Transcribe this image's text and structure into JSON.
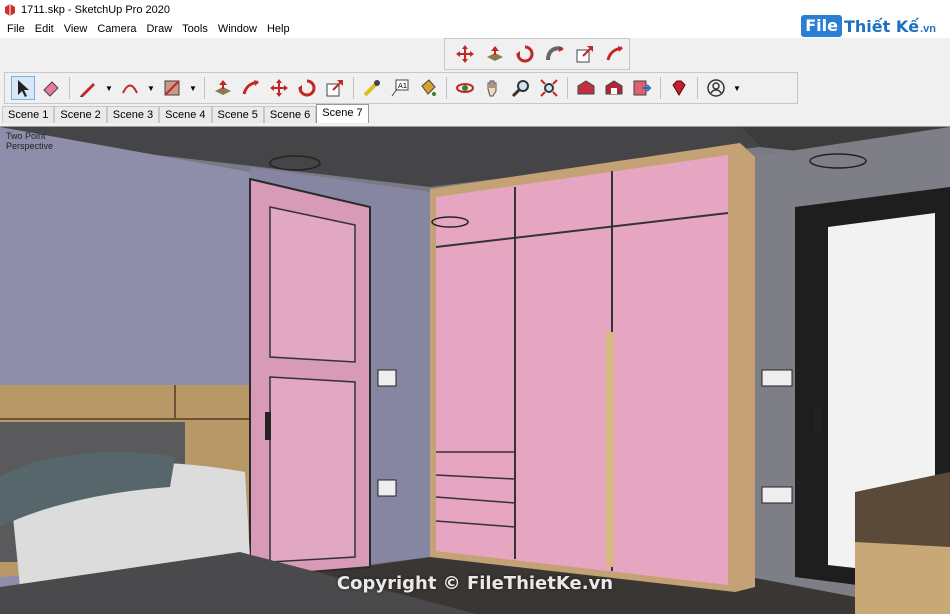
{
  "window": {
    "title": "1711.skp - SketchUp Pro 2020"
  },
  "menu": [
    "File",
    "Edit",
    "View",
    "Camera",
    "Draw",
    "Tools",
    "Window",
    "Help"
  ],
  "brand": {
    "file": "File",
    "rest": "Thiết Kế",
    "tld": ".vn"
  },
  "scenes": [
    "Scene 1",
    "Scene 2",
    "Scene 3",
    "Scene 4",
    "Scene 5",
    "Scene 6",
    "Scene 7"
  ],
  "active_scene": "Scene 7",
  "viewport": {
    "perspective_label_line1": "Two Point",
    "perspective_label_line2": "Perspective",
    "watermark": "Copyright © FileThietKe.vn"
  },
  "colors": {
    "accent": "#1e6fc2",
    "wardrobe": "#e8a8c4",
    "wall": "#8c8ca6"
  }
}
